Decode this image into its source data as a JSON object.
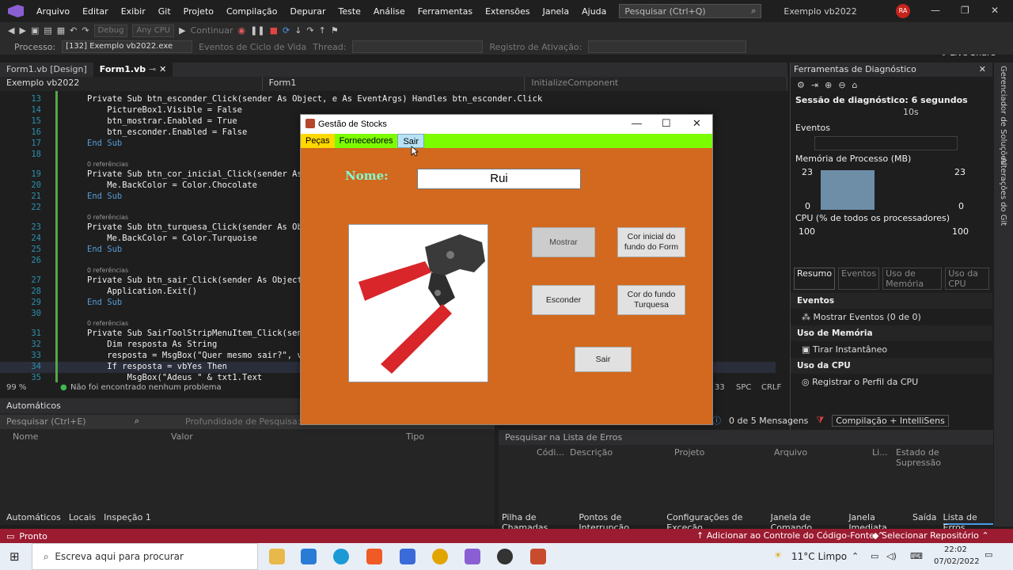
{
  "menubar": {
    "items": [
      "Arquivo",
      "Editar",
      "Exibir",
      "Git",
      "Projeto",
      "Compilação",
      "Depurar",
      "Teste",
      "Análise",
      "Ferramentas",
      "Extensões",
      "Janela",
      "Ajuda"
    ],
    "search_placeholder": "Pesquisar (Ctrl+Q)",
    "solution_title": "Exemplo vb2022",
    "user_initials": "RA"
  },
  "toolbar": {
    "config": "Debug",
    "platform": "Any CPU",
    "continue_label": "Continuar",
    "live_share": "Live Share",
    "process_label": "Processo:",
    "process_value": "[132] Exemplo vb2022.exe",
    "lifecycle_label": "Eventos de Ciclo de Vida",
    "thread_label": "Thread:",
    "activation_label": "Registro de Ativação:"
  },
  "editor": {
    "tabs": [
      "Form1.vb [Design]",
      "Form1.vb"
    ],
    "nav": [
      "Exemplo vb2022",
      "Form1",
      "InitializeComponent"
    ],
    "lines": [
      {
        "n": "13",
        "text": "Private Sub btn_esconder_Click(sender As Object, e As EventArgs) Handles btn_esconder.Click"
      },
      {
        "n": "14",
        "text": "    PictureBox1.Visible = False"
      },
      {
        "n": "15",
        "text": "    btn_mostrar.Enabled = True"
      },
      {
        "n": "16",
        "text": "    btn_esconder.Enabled = False"
      },
      {
        "n": "17",
        "text": "End Sub"
      },
      {
        "n": "18",
        "text": ""
      },
      {
        "n": "19",
        "text": "Private Sub btn_cor_inicial_Click(sender As"
      },
      {
        "n": "20",
        "text": "    Me.BackColor = Color.Chocolate"
      },
      {
        "n": "21",
        "text": "End Sub"
      },
      {
        "n": "22",
        "text": ""
      },
      {
        "n": "23",
        "text": "Private Sub btn_turquesa_Click(sender As Ob"
      },
      {
        "n": "24",
        "text": "    Me.BackColor = Color.Turquoise"
      },
      {
        "n": "25",
        "text": "End Sub"
      },
      {
        "n": "26",
        "text": ""
      },
      {
        "n": "27",
        "text": "Private Sub btn_sair_Click(sender As Object"
      },
      {
        "n": "28",
        "text": "    Application.Exit()"
      },
      {
        "n": "29",
        "text": "End Sub"
      },
      {
        "n": "30",
        "text": ""
      },
      {
        "n": "31",
        "text": "Private Sub SairToolStripMenuItem_Click(sen"
      },
      {
        "n": "32",
        "text": "    Dim resposta As String"
      },
      {
        "n": "33",
        "text": "    resposta = MsgBox(\"Quer mesmo sair?\", v"
      },
      {
        "n": "34",
        "text": "    If resposta = vbYes Then"
      },
      {
        "n": "35",
        "text": "        MsgBox(\"Adeus \" & txt1.Text"
      }
    ],
    "refs_label": "0 referências",
    "zoom": "99 %",
    "issues": "Não foi encontrado nenhum problema",
    "col": "33",
    "spc": "SPC",
    "crlf": "CRLF"
  },
  "diagnostics": {
    "title": "Ferramentas de Diagnóstico",
    "session": "Sessão de diagnóstico: 6 segundos",
    "timeline_mark": "10s",
    "events_label": "Eventos",
    "memory_label": "Memória de Processo (MB)",
    "mem_max": "23",
    "mem_min": "0",
    "cpu_label": "CPU (% de todos os processadores)",
    "cpu_max": "100",
    "tabs": [
      "Resumo",
      "Eventos",
      "Uso de Memória",
      "Uso da CPU"
    ],
    "sec_events": "Eventos",
    "show_events": "Mostrar Eventos (0 de 0)",
    "sec_memory": "Uso de Memória",
    "snapshot": "Tirar Instantâneo",
    "sec_cpu": "Uso da CPU",
    "cpu_profile": "Registrar o Perfil da CPU"
  },
  "rail": {
    "solution_manager": "Gerenciador de Soluções",
    "git_changes": "Alterações do Git"
  },
  "autos": {
    "title": "Automáticos",
    "search_placeholder": "Pesquisar (Ctrl+E)",
    "depth_label": "Profundidade de Pesquisa:",
    "columns": [
      "Nome",
      "Valor",
      "Tipo"
    ],
    "tabs": [
      "Automáticos",
      "Locais",
      "Inspeção 1"
    ]
  },
  "errors": {
    "messages": "0 de 5 Mensagens",
    "build_filter": "Compilação + IntelliSens",
    "search_placeholder": "Pesquisar na Lista de Erros",
    "columns": [
      "Códi...",
      "Descrição",
      "Projeto",
      "Arquivo",
      "Li...",
      "Estado de Supressão"
    ],
    "tabs": [
      "Pilha de Chamadas",
      "Pontos de Interrupção",
      "Configurações de Exceção",
      "Janela de Comando",
      "Janela Imediata",
      "Saída",
      "Lista de Erros"
    ]
  },
  "status": {
    "ready": "Pronto",
    "source_control": "Adicionar ao Controle do Código-Fonte",
    "repo": "Selecionar Repositório"
  },
  "taskbar": {
    "search_placeholder": "Escreva aqui para procurar",
    "weather": "11°C  Limpo",
    "time": "22:02",
    "date": "07/02/2022"
  },
  "form": {
    "title": "Gestão de Stocks",
    "menu": [
      "Peças",
      "Fornecedores",
      "Sair"
    ],
    "name_label": "Nome:",
    "name_value": "Rui",
    "btn_mostrar": "Mostrar",
    "btn_cor_inicial": "Cor inicial do fundo do Form",
    "btn_esconder": "Esconder",
    "btn_turquesa": "Cor do fundo Turquesa",
    "btn_sair": "Sair",
    "back_color": "#D2691E",
    "menu_color": "#7CFC00"
  }
}
